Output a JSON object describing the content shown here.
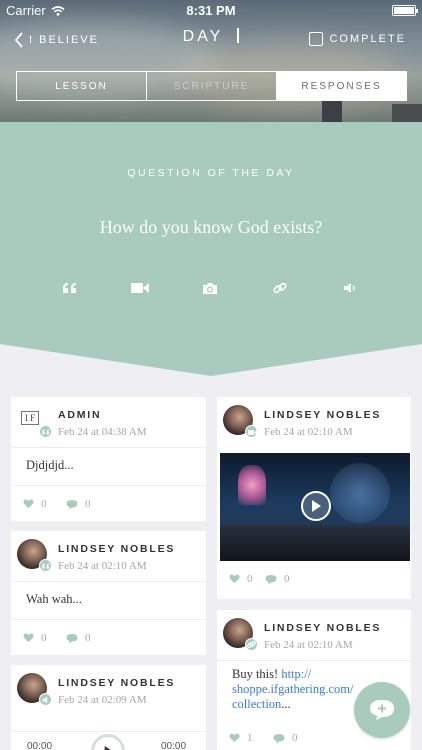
{
  "status_bar": {
    "carrier": "Carrier",
    "time": "8:31 PM"
  },
  "nav": {
    "back_label": "I BELIEVE",
    "title": "DAY",
    "complete_label": "COMPLETE"
  },
  "tabs": [
    {
      "label": "LESSON",
      "state": "normal"
    },
    {
      "label": "SCRIPTURE",
      "state": "dim"
    },
    {
      "label": "RESPONSES",
      "state": "active"
    }
  ],
  "question": {
    "label": "QUESTION OF THE DAY",
    "text": "How do you know God exists?",
    "response_types": [
      "quote-icon",
      "video-icon",
      "camera-icon",
      "link-icon",
      "audio-icon"
    ]
  },
  "colors": {
    "accent": "#a8cbbd",
    "background": "#eeeef3",
    "link": "#3a7bd5"
  },
  "cards": [
    {
      "name": "ADMIN",
      "date": "Feb 24 at 04:38 AM",
      "text": "Djdjdjd...",
      "likes": "0",
      "comments": "0",
      "avatar": "if-logo"
    },
    {
      "name": "LINDSEY NOBLES",
      "date": "Feb 24 at 02:10 AM",
      "type": "video",
      "likes": "0",
      "comments": "0"
    },
    {
      "name": "LINDSEY NOBLES",
      "date": "Feb 24 at 02:10 AM",
      "text": "Wah wah...",
      "likes": "0",
      "comments": "0"
    },
    {
      "name": "LINDSEY NOBLES",
      "date": "Feb 24 at 02:10 AM",
      "text_before": "Buy this! ",
      "link": "http://shoppe.ifgathering.com/collection",
      "link_display": [
        "http://",
        "shoppe.ifgathering.com/",
        "collection"
      ],
      "text_after": "...",
      "likes": "1",
      "comments": "0"
    },
    {
      "name": "LINDSEY NOBLES",
      "date": "Feb 24 at 02:09 AM",
      "type": "audio",
      "audio_start": "00:00",
      "audio_end": "00:00"
    }
  ]
}
